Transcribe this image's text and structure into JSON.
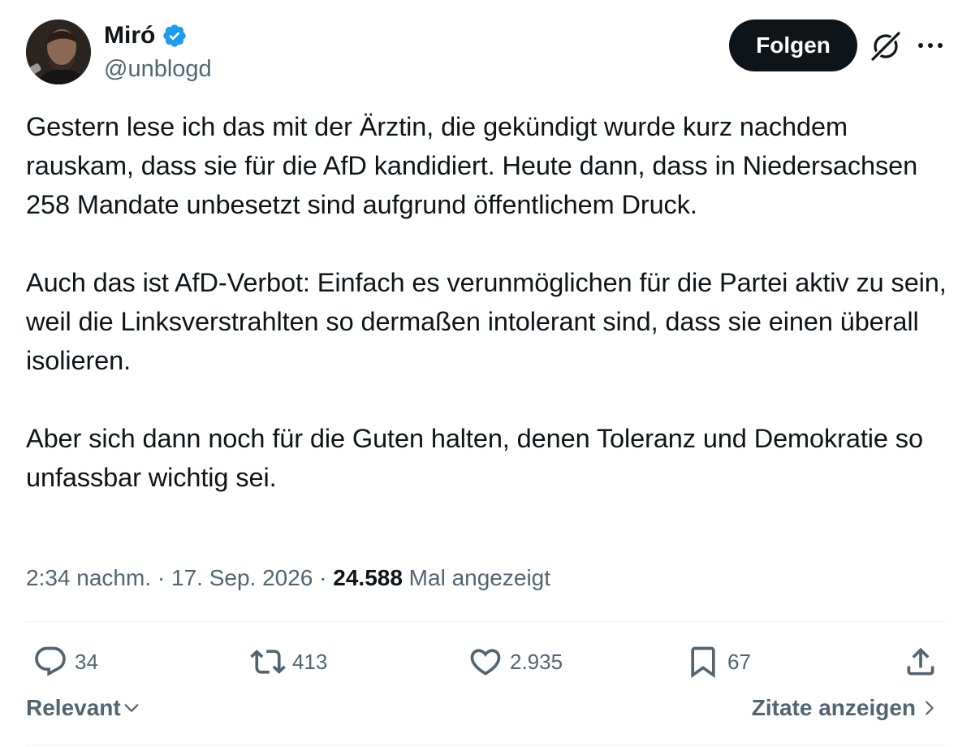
{
  "author": {
    "display_name": "Miró",
    "handle": "@unblogd",
    "verified": true
  },
  "header": {
    "follow_label": "Folgen",
    "icons": [
      "grok-icon",
      "more-icon"
    ]
  },
  "post": {
    "paragraphs": [
      "Gestern lese ich das mit der Ärztin, die gekündigt wurde kurz nachdem rauskam, dass sie für die AfD kandidiert. Heute dann, dass in Niedersachsen 258 Mandate unbesetzt sind aufgrund öffentlichem Druck.",
      "Auch das ist AfD-Verbot: Einfach es verunmöglichen für die Partei aktiv zu sein, weil die Linksverstrahlten so dermaßen intolerant sind, dass sie einen überall isolieren.",
      "Aber sich dann noch für die Guten halten, denen Toleranz und Demokratie so unfassbar wichtig sei."
    ]
  },
  "meta": {
    "time": "2:34 nachm.",
    "separator": " · ",
    "date": "17. Sep. 2026",
    "views_count": "24.588",
    "views_label": " Mal angezeigt"
  },
  "actions": {
    "replies": "34",
    "reposts": "413",
    "likes": "2.935",
    "bookmarks": "67"
  },
  "footer": {
    "sort_label": "Relevant",
    "quotes_label": "Zitate anzeigen"
  },
  "colors": {
    "text": "#0f1419",
    "secondary": "#536471",
    "verified": "#1d9bf0",
    "divider": "#eff3f4"
  }
}
